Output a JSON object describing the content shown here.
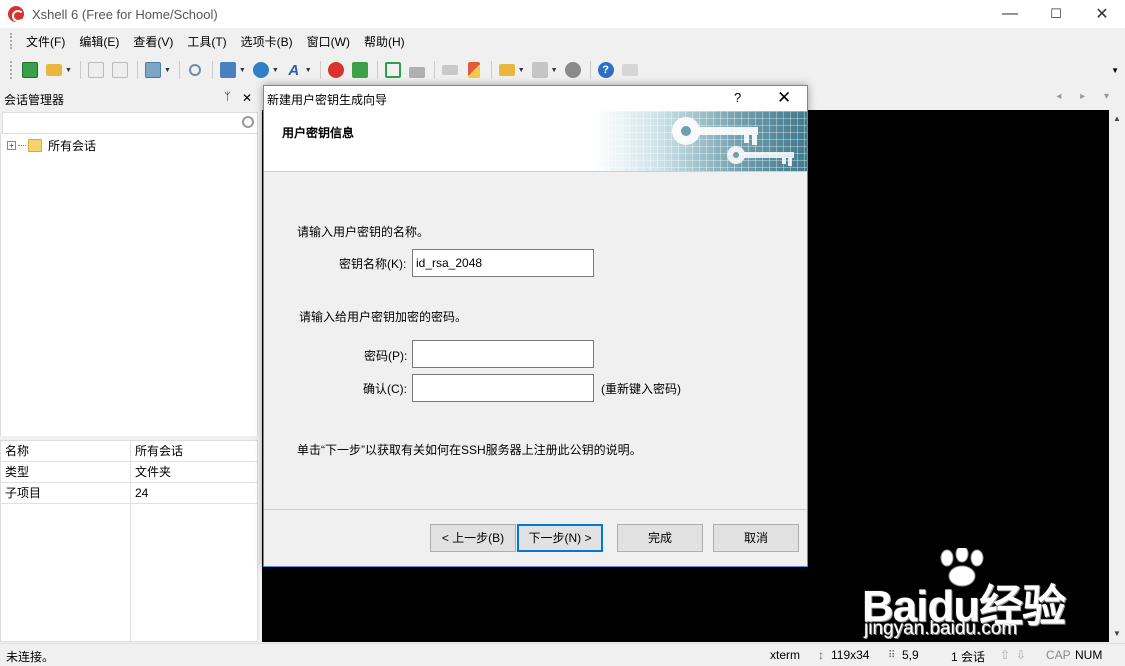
{
  "window": {
    "title": "Xshell 6 (Free for Home/School)",
    "minimize": "—",
    "maximize": "☐",
    "close": "✕"
  },
  "menu": [
    "文件(F)",
    "编辑(E)",
    "查看(V)",
    "工具(T)",
    "选项卡(B)",
    "窗口(W)",
    "帮助(H)"
  ],
  "toolbar_icons": [
    "new-session-icon",
    "open-folder-icon",
    "connect-icon",
    "disconnect-icon",
    "properties-icon",
    "find-icon",
    "transfer-icon",
    "globe-icon",
    "font-icon",
    "xftp-icon",
    "green-terminal-icon",
    "fullscreen-icon",
    "lock-icon",
    "keyboard-icon",
    "highlight-icon",
    "new-folder-icon",
    "layout-icon",
    "settings-icon",
    "help-icon",
    "chat-icon"
  ],
  "session_panel": {
    "title": "会话管理器",
    "pin": "ᛘ",
    "close": "✕",
    "search_placeholder": "",
    "tree": [
      {
        "label": "所有会话",
        "expander": "+"
      }
    ],
    "properties": [
      {
        "key": "名称",
        "value": "所有会话"
      },
      {
        "key": "类型",
        "value": "文件夹"
      },
      {
        "key": "子项目",
        "value": "24"
      }
    ]
  },
  "tab_nav": "◂ ▸ ▾",
  "statusbar": {
    "left": "未连接。",
    "term": "xterm",
    "size": "119x34",
    "cursor": "5,9",
    "sessions": "1 会话",
    "cap": "CAP",
    "num": "NUM"
  },
  "dialog": {
    "title": "新建用户密钥生成向导",
    "help": "?",
    "close": "✕",
    "header": "用户密钥信息",
    "prompt_name": "请输入用户密钥的名称。",
    "name_label": "密钥名称(K):",
    "name_value": "id_rsa_2048",
    "prompt_password": "请输入给用户密钥加密的密码。",
    "password_label": "密码(P):",
    "password_value": "",
    "confirm_label": "确认(C):",
    "confirm_value": "",
    "confirm_hint": "(重新键入密码)",
    "note": "单击“下一步”以获取有关如何在SSH服务器上注册此公钥的说明。",
    "buttons": {
      "back": "< 上一步(B)",
      "next": "下一步(N) >",
      "finish": "完成",
      "cancel": "取消"
    }
  },
  "watermark": {
    "brand": "Baidu经验",
    "site": "jingyan.baidu.com"
  },
  "colors": {
    "terminal_bg": "#000000",
    "dialog_border": "#5a8bd6",
    "default_button_border": "#0078d7",
    "folder": "#f6d36b"
  }
}
